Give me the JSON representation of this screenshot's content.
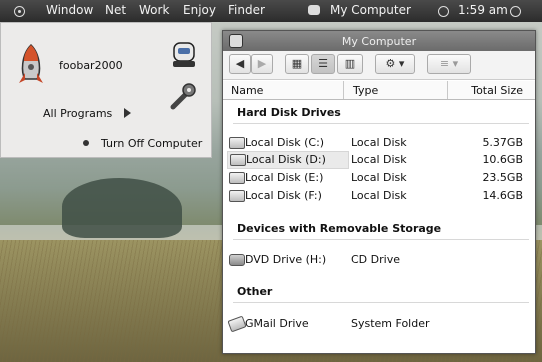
{
  "menubar": {
    "items": [
      "Window",
      "Net",
      "Work",
      "Enjoy",
      "Finder"
    ],
    "active_window": "My Computer",
    "clock": "1:59 am"
  },
  "start_menu": {
    "username": "foobar2000",
    "all_programs": "All Programs",
    "turn_off": "Turn Off Computer"
  },
  "window": {
    "title": "My Computer",
    "columns": [
      "Name",
      "Type",
      "Total Size"
    ],
    "groups": [
      {
        "label": "Hard Disk Drives",
        "items": [
          {
            "name": "Local Disk (C:)",
            "type": "Local Disk",
            "size": "5.37GB"
          },
          {
            "name": "Local Disk (D:)",
            "type": "Local Disk",
            "size": "10.6GB"
          },
          {
            "name": "Local Disk (E:)",
            "type": "Local Disk",
            "size": "23.5GB"
          },
          {
            "name": "Local Disk (F:)",
            "type": "Local Disk",
            "size": "14.6GB"
          }
        ]
      },
      {
        "label": "Devices with Removable Storage",
        "items": [
          {
            "name": "DVD Drive (H:)",
            "type": "CD Drive",
            "size": ""
          }
        ]
      },
      {
        "label": "Other",
        "items": [
          {
            "name": "GMail Drive",
            "type": "System Folder",
            "size": ""
          }
        ]
      }
    ]
  },
  "toolbar_icons": [
    "back-icon",
    "forward-icon",
    "icon-view-icon",
    "list-view-icon",
    "column-view-icon",
    "gear-icon",
    "arrange-icon"
  ]
}
